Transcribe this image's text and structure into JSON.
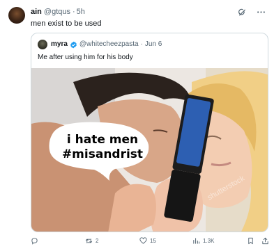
{
  "author": {
    "name": "ain",
    "handle": "@gtqus",
    "separator": "·",
    "time": "5h"
  },
  "tweet_text": "men exist to be used",
  "header_icons": [
    "grok-icon",
    "more-icon"
  ],
  "quoted": {
    "name": "myra",
    "verified": true,
    "handle": "@whitecheezpasta",
    "separator": "·",
    "date": "Jun 6",
    "text": "Me after using him for his body",
    "image": {
      "caption_line1": "i hate men",
      "caption_line2": "#misandrist",
      "watermark": "shutterstock"
    }
  },
  "actions": {
    "reply": {
      "icon": "reply-icon",
      "count": ""
    },
    "repost": {
      "icon": "repost-icon",
      "count": "2"
    },
    "like": {
      "icon": "like-icon",
      "count": "15"
    },
    "views": {
      "icon": "views-icon",
      "count": "1.3K"
    },
    "bookmark": {
      "icon": "bookmark-icon"
    },
    "share": {
      "icon": "share-icon"
    }
  },
  "colors": {
    "text": "#0f1419",
    "secondary": "#536471",
    "border": "#cfd9de",
    "verified": "#1d9bf0"
  }
}
